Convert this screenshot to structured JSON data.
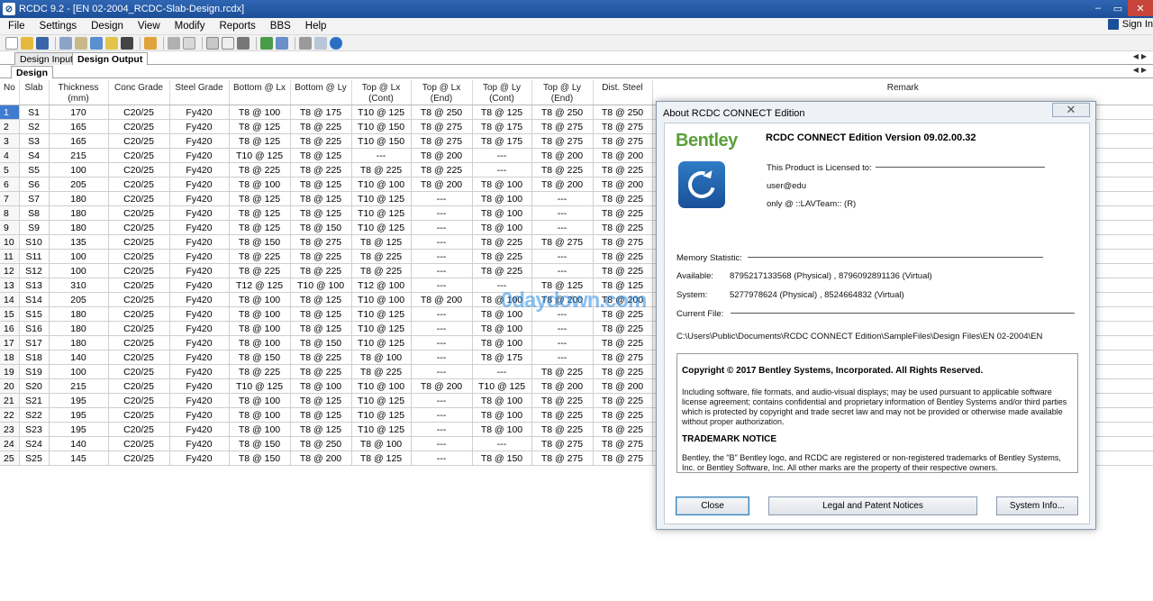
{
  "window": {
    "title": "RCDC 9.2 - [EN 02-2004_RCDC-Slab-Design.rcdx]",
    "minimize": "–",
    "maximize": "▭",
    "close": "✕"
  },
  "menu": [
    "File",
    "Settings",
    "Design",
    "View",
    "Modify",
    "Reports",
    "BBS",
    "Help"
  ],
  "sign_in": "Sign In",
  "tabs": {
    "row1": [
      "Design Input",
      "Design Output"
    ],
    "row2": [
      "Design"
    ]
  },
  "table": {
    "headers": [
      "No",
      "Slab",
      "Thickness (mm)",
      "Conc Grade",
      "Steel Grade",
      "Bottom @ Lx",
      "Bottom @ Ly",
      "Top @ Lx (Cont)",
      "Top @ Lx (End)",
      "Top @ Ly (Cont)",
      "Top @ Ly (End)",
      "Dist. Steel",
      "Remark"
    ],
    "rows": [
      [
        "1",
        "S1",
        "170",
        "C20/25",
        "Fy420",
        "T8 @ 100",
        "T8 @ 175",
        "T10 @ 125",
        "T8 @ 250",
        "T8 @ 125",
        "T8 @ 250",
        "T8 @ 250"
      ],
      [
        "2",
        "S2",
        "165",
        "C20/25",
        "Fy420",
        "T8 @ 125",
        "T8 @ 225",
        "T10 @ 150",
        "T8 @ 275",
        "T8 @ 175",
        "T8 @ 275",
        "T8 @ 275"
      ],
      [
        "3",
        "S3",
        "165",
        "C20/25",
        "Fy420",
        "T8 @ 125",
        "T8 @ 225",
        "T10 @ 150",
        "T8 @ 275",
        "T8 @ 175",
        "T8 @ 275",
        "T8 @ 275"
      ],
      [
        "4",
        "S4",
        "215",
        "C20/25",
        "Fy420",
        "T10 @ 125",
        "T8 @ 125",
        "---",
        "T8 @ 200",
        "---",
        "T8 @ 200",
        "T8 @ 200"
      ],
      [
        "5",
        "S5",
        "100",
        "C20/25",
        "Fy420",
        "T8 @ 225",
        "T8 @ 225",
        "T8 @ 225",
        "T8 @ 225",
        "---",
        "T8 @ 225",
        "T8 @ 225"
      ],
      [
        "6",
        "S6",
        "205",
        "C20/25",
        "Fy420",
        "T8 @ 100",
        "T8 @ 125",
        "T10 @ 100",
        "T8 @ 200",
        "T8 @ 100",
        "T8 @ 200",
        "T8 @ 200"
      ],
      [
        "7",
        "S7",
        "180",
        "C20/25",
        "Fy420",
        "T8 @ 125",
        "T8 @ 125",
        "T10 @ 125",
        "---",
        "T8 @ 100",
        "---",
        "T8 @ 225"
      ],
      [
        "8",
        "S8",
        "180",
        "C20/25",
        "Fy420",
        "T8 @ 125",
        "T8 @ 125",
        "T10 @ 125",
        "---",
        "T8 @ 100",
        "---",
        "T8 @ 225"
      ],
      [
        "9",
        "S9",
        "180",
        "C20/25",
        "Fy420",
        "T8 @ 125",
        "T8 @ 150",
        "T10 @ 125",
        "---",
        "T8 @ 100",
        "---",
        "T8 @ 225"
      ],
      [
        "10",
        "S10",
        "135",
        "C20/25",
        "Fy420",
        "T8 @ 150",
        "T8 @ 275",
        "T8 @ 125",
        "---",
        "T8 @ 225",
        "T8 @ 275",
        "T8 @ 275"
      ],
      [
        "11",
        "S11",
        "100",
        "C20/25",
        "Fy420",
        "T8 @ 225",
        "T8 @ 225",
        "T8 @ 225",
        "---",
        "T8 @ 225",
        "---",
        "T8 @ 225"
      ],
      [
        "12",
        "S12",
        "100",
        "C20/25",
        "Fy420",
        "T8 @ 225",
        "T8 @ 225",
        "T8 @ 225",
        "---",
        "T8 @ 225",
        "---",
        "T8 @ 225"
      ],
      [
        "13",
        "S13",
        "310",
        "C20/25",
        "Fy420",
        "T12 @ 125",
        "T10 @ 100",
        "T12 @ 100",
        "---",
        "---",
        "T8 @ 125",
        "T8 @ 125"
      ],
      [
        "14",
        "S14",
        "205",
        "C20/25",
        "Fy420",
        "T8 @ 100",
        "T8 @ 125",
        "T10 @ 100",
        "T8 @ 200",
        "T8 @ 100",
        "T8 @ 200",
        "T8 @ 200"
      ],
      [
        "15",
        "S15",
        "180",
        "C20/25",
        "Fy420",
        "T8 @ 100",
        "T8 @ 125",
        "T10 @ 125",
        "---",
        "T8 @ 100",
        "---",
        "T8 @ 225"
      ],
      [
        "16",
        "S16",
        "180",
        "C20/25",
        "Fy420",
        "T8 @ 100",
        "T8 @ 125",
        "T10 @ 125",
        "---",
        "T8 @ 100",
        "---",
        "T8 @ 225"
      ],
      [
        "17",
        "S17",
        "180",
        "C20/25",
        "Fy420",
        "T8 @ 100",
        "T8 @ 150",
        "T10 @ 125",
        "---",
        "T8 @ 100",
        "---",
        "T8 @ 225"
      ],
      [
        "18",
        "S18",
        "140",
        "C20/25",
        "Fy420",
        "T8 @ 150",
        "T8 @ 225",
        "T8 @ 100",
        "---",
        "T8 @ 175",
        "---",
        "T8 @ 275"
      ],
      [
        "19",
        "S19",
        "100",
        "C20/25",
        "Fy420",
        "T8 @ 225",
        "T8 @ 225",
        "T8 @ 225",
        "---",
        "---",
        "T8 @ 225",
        "T8 @ 225"
      ],
      [
        "20",
        "S20",
        "215",
        "C20/25",
        "Fy420",
        "T10 @ 125",
        "T8 @ 100",
        "T10 @ 100",
        "T8 @ 200",
        "T10 @ 125",
        "T8 @ 200",
        "T8 @ 200"
      ],
      [
        "21",
        "S21",
        "195",
        "C20/25",
        "Fy420",
        "T8 @ 100",
        "T8 @ 125",
        "T10 @ 125",
        "---",
        "T8 @ 100",
        "T8 @ 225",
        "T8 @ 225"
      ],
      [
        "22",
        "S22",
        "195",
        "C20/25",
        "Fy420",
        "T8 @ 100",
        "T8 @ 125",
        "T10 @ 125",
        "---",
        "T8 @ 100",
        "T8 @ 225",
        "T8 @ 225"
      ],
      [
        "23",
        "S23",
        "195",
        "C20/25",
        "Fy420",
        "T8 @ 100",
        "T8 @ 125",
        "T10 @ 125",
        "---",
        "T8 @ 100",
        "T8 @ 225",
        "T8 @ 225"
      ],
      [
        "24",
        "S24",
        "140",
        "C20/25",
        "Fy420",
        "T8 @ 150",
        "T8 @ 250",
        "T8 @ 100",
        "---",
        "---",
        "T8 @ 275",
        "T8 @ 275"
      ],
      [
        "25",
        "S25",
        "145",
        "C20/25",
        "Fy420",
        "T8 @ 150",
        "T8 @ 200",
        "T8 @ 125",
        "---",
        "T8 @ 150",
        "T8 @ 275",
        "T8 @ 275"
      ]
    ]
  },
  "about_dialog": {
    "title": "About RCDC CONNECT Edition",
    "brand": "Bentley",
    "product": "RCDC CONNECT Edition  Version 09.02.00.32",
    "licensed_label": "This Product is Licensed to:",
    "licensed_user": "user@edu",
    "licensed_note": "only @ ::LAVTeam:: (R)",
    "memory_label": "Memory Statistic:",
    "available_label": "Available:",
    "available_value": "8795217133568 (Physical) , 8796092891136 (Virtual)",
    "system_label": "System:",
    "system_value": "5277978624 (Physical) , 8524664832 (Virtual)",
    "current_file_label": "Current File:",
    "current_file_path": "C:\\Users\\Public\\Documents\\RCDC CONNECT Edition\\SampleFiles\\Design Files\\EN 02-2004\\EN",
    "copyright": "Copyright © 2017 Bentley Systems, Incorporated. All Rights Reserved.",
    "license_text": "Including software, file formats, and audio-visual displays; may be used pursuant to applicable software license agreement; contains confidential and proprietary information of Bentley Systems and/or third parties which is protected by copyright and trade secret law and may not be provided or otherwise made available without proper authorization.",
    "trademark_title": "TRADEMARK NOTICE",
    "trademark_text": "Bentley, the \"B\" Bentley logo, and RCDC are registered or non-registered trademarks of Bentley Systems, Inc. or Bentley Software, Inc. All other marks are the property of their respective owners.",
    "buttons": {
      "close": "Close",
      "legal": "Legal and Patent Notices",
      "system_info": "System Info..."
    }
  },
  "watermark": "0daydown.com",
  "colors": {
    "titlebar": "#1d4f98",
    "selected_row": "#3f7bd0",
    "bentley_green": "#5b9f3a"
  }
}
